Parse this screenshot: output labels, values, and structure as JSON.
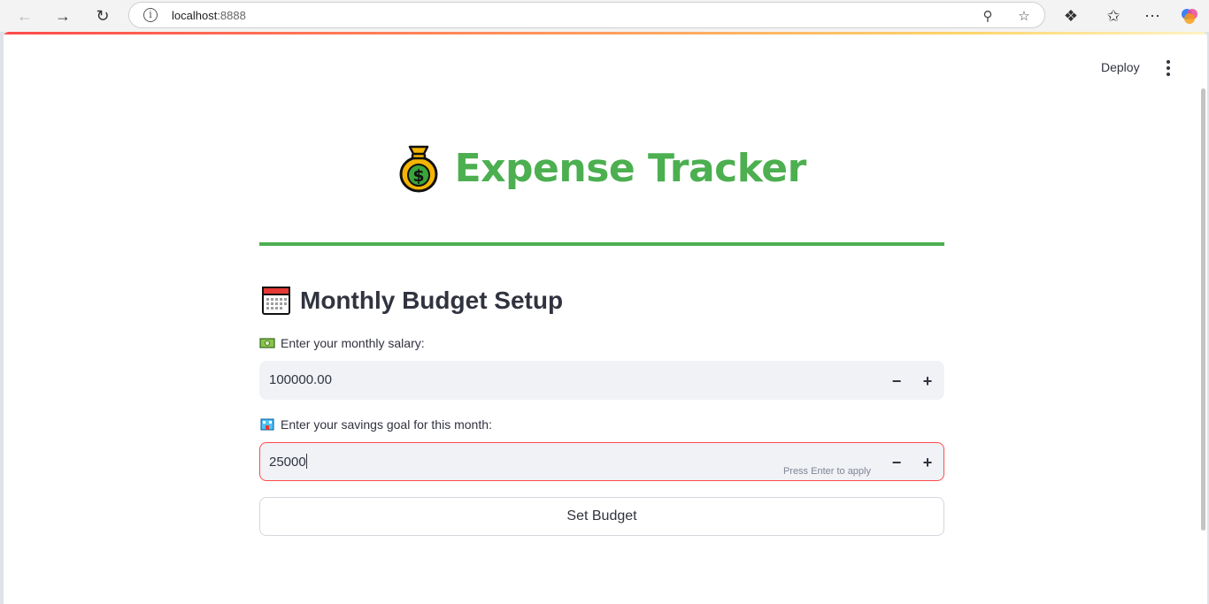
{
  "browser": {
    "url_host": "localhost",
    "url_port": ":8888"
  },
  "app": {
    "deploy_label": "Deploy",
    "title": "Expense Tracker",
    "section_title": "Monthly Budget Setup",
    "salary": {
      "label": "Enter your monthly salary:",
      "value": "100000.00"
    },
    "savings": {
      "label": "Enter your savings goal for this month:",
      "value": "25000",
      "hint": "Press Enter to apply"
    },
    "submit_label": "Set Budget",
    "colors": {
      "accent_green": "#4caf50",
      "focus_red": "#ff4b4b",
      "text": "#31333f"
    }
  }
}
